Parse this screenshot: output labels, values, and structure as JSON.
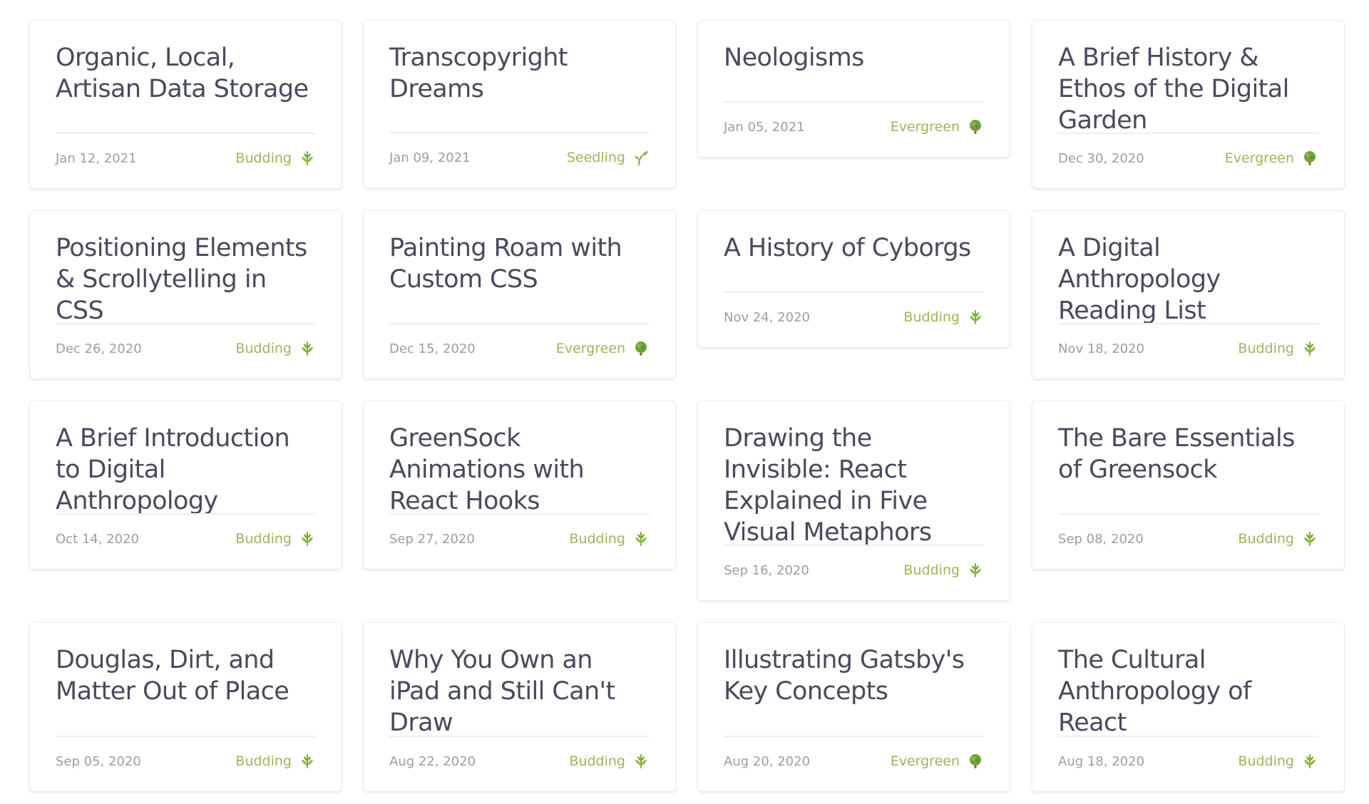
{
  "notes": [
    {
      "title": "Organic, Local, Artisan Data Storage",
      "date": "Jan 12, 2021",
      "stage": "Budding",
      "icon": "budding-leaf-icon"
    },
    {
      "title": "Transcopyright Dreams",
      "date": "Jan 09, 2021",
      "stage": "Seedling",
      "icon": "seedling-sprout-icon"
    },
    {
      "title": "Neologisms",
      "date": "Jan 05, 2021",
      "stage": "Evergreen",
      "icon": "evergreen-tree-icon"
    },
    {
      "title": "A Brief History & Ethos of the Digital Garden",
      "date": "Dec 30, 2020",
      "stage": "Evergreen",
      "icon": "evergreen-tree-icon"
    },
    {
      "title": "Positioning Elements & Scrollytelling in CSS",
      "date": "Dec 26, 2020",
      "stage": "Budding",
      "icon": "budding-leaf-icon"
    },
    {
      "title": "Painting Roam with Custom CSS",
      "date": "Dec 15, 2020",
      "stage": "Evergreen",
      "icon": "evergreen-tree-icon"
    },
    {
      "title": "A History of Cyborgs",
      "date": "Nov 24, 2020",
      "stage": "Budding",
      "icon": "budding-leaf-icon"
    },
    {
      "title": "A Digital Anthropology Reading List",
      "date": "Nov 18, 2020",
      "stage": "Budding",
      "icon": "budding-leaf-icon"
    },
    {
      "title": "A Brief Introduction to Digital Anthropology",
      "date": "Oct 14, 2020",
      "stage": "Budding",
      "icon": "budding-leaf-icon"
    },
    {
      "title": "GreenSock Animations with React Hooks",
      "date": "Sep 27, 2020",
      "stage": "Budding",
      "icon": "budding-leaf-icon"
    },
    {
      "title": "Drawing the Invisible: React Explained in Five Visual Metaphors",
      "date": "Sep 16, 2020",
      "stage": "Budding",
      "icon": "budding-leaf-icon"
    },
    {
      "title": "The Bare Essentials of Greensock",
      "date": "Sep 08, 2020",
      "stage": "Budding",
      "icon": "budding-leaf-icon"
    },
    {
      "title": "Douglas, Dirt, and Matter Out of Place",
      "date": "Sep 05, 2020",
      "stage": "Budding",
      "icon": "budding-leaf-icon"
    },
    {
      "title": "Why You Own an iPad and Still Can't Draw",
      "date": "Aug 22, 2020",
      "stage": "Budding",
      "icon": "budding-leaf-icon"
    },
    {
      "title": "Illustrating Gatsby's Key Concepts",
      "date": "Aug 20, 2020",
      "stage": "Evergreen",
      "icon": "evergreen-tree-icon"
    },
    {
      "title": "The Cultural Anthropology of React",
      "date": "Aug 18, 2020",
      "stage": "Budding",
      "icon": "budding-leaf-icon"
    }
  ],
  "colors": {
    "title": "#484a5e",
    "date": "#9a9cab",
    "stage": "#9bb55a",
    "card_border": "#eceef3",
    "divider": "#eceef1"
  }
}
